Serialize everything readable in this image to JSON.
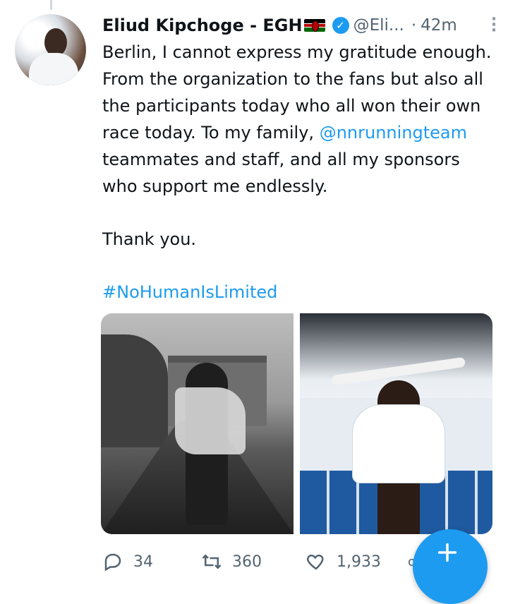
{
  "tweet": {
    "author_name": "Eliud Kipchoge - EGH",
    "verified_icon": "verified-badge-icon",
    "handle": "@Eli...",
    "separator": "·",
    "time": "42m",
    "more_icon": "more-vertical-icon",
    "text": {
      "line1": "Berlin, I cannot express my gratitude enough. From the organization to the fans but also all the participants today who all won their own race today. To my family,",
      "mention": "@nnrunningteam",
      "line2_rest": " teammates and staff, and all my  sponsors who support me endlessly.",
      "thanks": "Thank you.",
      "hashtag": "#NoHumanIsLimited"
    }
  },
  "actions": {
    "reply": {
      "icon": "reply-icon",
      "count": "34"
    },
    "retweet": {
      "icon": "retweet-icon",
      "count": "360"
    },
    "like": {
      "icon": "heart-icon",
      "count": "1,933"
    }
  },
  "fab": {
    "icon": "plus-icon"
  },
  "colors": {
    "accent": "#1d9bf0",
    "text": "#0f1419",
    "secondary": "#536471"
  }
}
